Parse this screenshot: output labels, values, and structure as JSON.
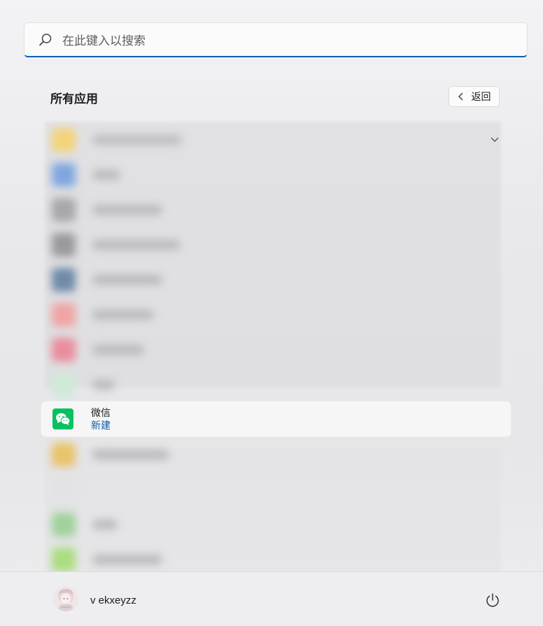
{
  "search": {
    "placeholder": "在此键入以搜索",
    "icon": "search-icon"
  },
  "header": {
    "title": "所有应用",
    "back_label": "返回",
    "back_icon": "chevron-left-icon"
  },
  "list": {
    "expand_icon": "chevron-down-icon",
    "highlighted_app": {
      "name": "微信",
      "badge": "新建",
      "icon": "wechat-icon",
      "icon_color": "#07c160"
    }
  },
  "footer": {
    "user_name": "v ekxeyzz",
    "avatar_icon": "user-avatar",
    "power_icon": "power-icon"
  },
  "colors": {
    "accent": "#0a5fb4",
    "badge_text": "#0b5ea8"
  }
}
